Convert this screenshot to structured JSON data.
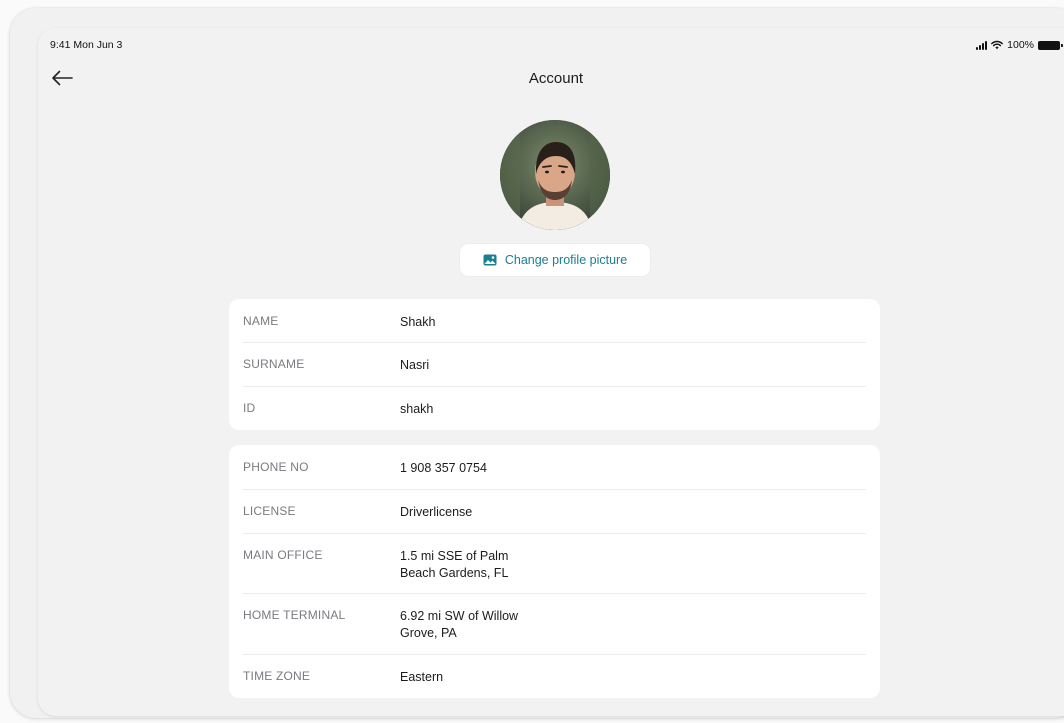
{
  "status_bar": {
    "time": "9:41 Mon Jun 3",
    "battery": "100%"
  },
  "header": {
    "title": "Account"
  },
  "profile": {
    "change_picture_label": "Change profile picture"
  },
  "identity_section": {
    "rows": [
      {
        "label": "NAME",
        "value": "Shakh"
      },
      {
        "label": "SURNAME",
        "value": "Nasri"
      },
      {
        "label": "ID",
        "value": "shakh"
      }
    ]
  },
  "details_section": {
    "rows": [
      {
        "label": "PHONE NO",
        "value": "1 908 357 0754"
      },
      {
        "label": "LICENSE",
        "value": "Driverlicense"
      },
      {
        "label": "MAIN OFFICE",
        "value": "1.5 mi SSE of Palm\nBeach Gardens, FL"
      },
      {
        "label": "HOME TERMINAL",
        "value": "6.92 mi SW of Willow\nGrove, PA"
      },
      {
        "label": "TIME ZONE",
        "value": "Eastern"
      }
    ]
  },
  "colors": {
    "accent": "#1a7f8f",
    "background": "#f2f2f3",
    "card": "#ffffff"
  }
}
